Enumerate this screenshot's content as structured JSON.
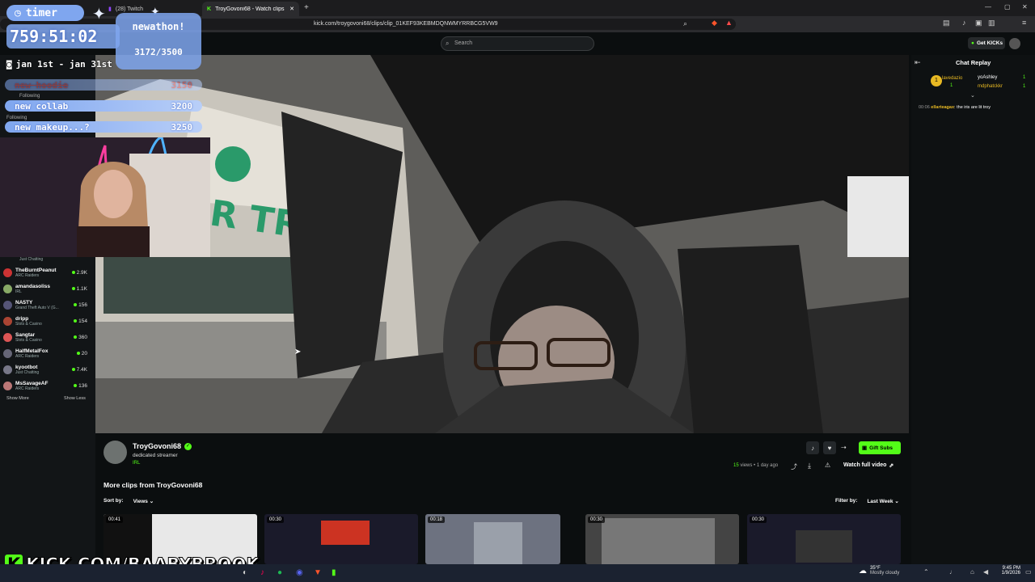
{
  "browser": {
    "tabs": [
      {
        "label": "(28) Twitch",
        "active": false
      },
      {
        "label": "TroyGovoni68 - Watch clips on K",
        "active": true
      }
    ],
    "url": "kick.com/troygovoni68/clips/clip_01KEF93KEBMDQNWMYRRBCG5VW9"
  },
  "kick": {
    "search_placeholder": "Search",
    "get_kicks_label": "Get KICKs"
  },
  "overlay": {
    "timer_label": "timer",
    "timer_value": "759:51:02",
    "dates": "jan 1st - jan 31st",
    "goal_label": "newathon!",
    "goal_value": "3172/3500",
    "goals": [
      {
        "label": "new hoodie",
        "value": "3150"
      },
      {
        "label": "new collab",
        "value": "3200"
      },
      {
        "label": "new makeup...?",
        "value": "3250"
      }
    ],
    "banner": "KICK.COM/BAABYBROOK"
  },
  "sidebar": {
    "following_labels": [
      "Following",
      "Following"
    ],
    "top_category": "Just Chatting",
    "channels": [
      {
        "name": "TheBurntPeanut",
        "category": "ARC Raiders",
        "viewers": "2.9K"
      },
      {
        "name": "amandasoliss",
        "category": "IRL",
        "viewers": "1.1K"
      },
      {
        "name": "NA5TY",
        "category": "Grand Theft Auto V (G...",
        "viewers": "156"
      },
      {
        "name": "dripp",
        "category": "Slots & Casino",
        "viewers": "154"
      },
      {
        "name": "Sangtar",
        "category": "Slots & Casino",
        "viewers": "360"
      },
      {
        "name": "HalfMetalFox",
        "category": "ARC Raiders",
        "viewers": "20"
      },
      {
        "name": "kyootbot",
        "category": "Just Chatting",
        "viewers": "7.4K"
      },
      {
        "name": "MsSavageAF",
        "category": "ARC Raiders",
        "viewers": "136"
      }
    ],
    "show_more": "Show More",
    "show_less": "Show Less"
  },
  "chat": {
    "title": "Chat Replay",
    "gifters": [
      {
        "name": "lavedazio",
        "count": "1"
      },
      {
        "name": "yoAshley",
        "count": "1"
      },
      {
        "name": "mdphatckkr",
        "count": "1"
      }
    ],
    "messages": [
      {
        "time": "00:06",
        "user": "ellarteagax",
        "text": "the iris are lit troy"
      }
    ]
  },
  "clip_info": {
    "streamer": "TroyGovoni68",
    "tagline": "dedicated streamer",
    "category": "IRL",
    "gift_subs_label": "Gift Subs",
    "views_count": "15",
    "views_word": "views",
    "age": "1 day ago",
    "watch_full_label": "Watch full video"
  },
  "more_clips": {
    "title": "More clips from TroyGovoni68",
    "sort_label": "Sort by:",
    "sort_value": "Views",
    "filter_label": "Filter by:",
    "filter_value": "Last Week",
    "clips": [
      {
        "duration": "00:41"
      },
      {
        "duration": "00:30"
      },
      {
        "duration": "00:18"
      },
      {
        "duration": "00:30"
      },
      {
        "duration": "00:30"
      }
    ]
  },
  "taskbar": {
    "temp": "35°F",
    "weather": "Mostly cloudy",
    "time": "9:45 PM",
    "date": "1/9/2026"
  },
  "colors": {
    "kick_green": "#53fc18",
    "overlay_blue": "#7fa6ef",
    "page_bg": "#0b0e0f"
  }
}
